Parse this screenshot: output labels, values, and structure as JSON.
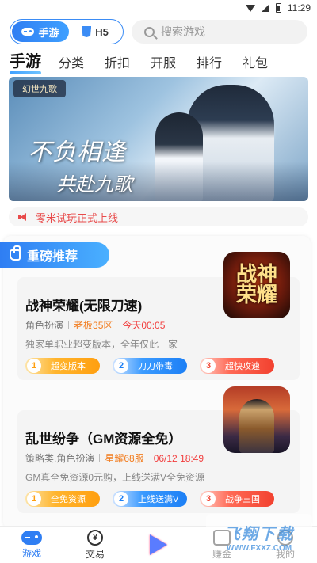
{
  "status_bar": {
    "time": "11:29"
  },
  "header": {
    "mode_active_label": "手游",
    "mode_inactive_label": "H5",
    "search_placeholder": "搜索游戏"
  },
  "tabs": [
    {
      "label": "手游",
      "active": true
    },
    {
      "label": "分类"
    },
    {
      "label": "折扣"
    },
    {
      "label": "开服"
    },
    {
      "label": "排行"
    },
    {
      "label": "礼包"
    }
  ],
  "banner": {
    "logo_text": "幻世九歌",
    "slogan_line1": "不负相逢",
    "slogan_line2": "共赴九歌"
  },
  "notice": {
    "text": "零米试玩正式上线"
  },
  "section": {
    "title": "重磅推荐",
    "games": [
      {
        "title": "战神荣耀(无限刀速)",
        "category": "角色扮演",
        "server": "老板35区",
        "time": "今天00:05",
        "desc": "独家单职业超变版本，全年仅此一家",
        "icon_text": "战神荣耀",
        "tags": [
          {
            "num": "1",
            "label": "超变版本",
            "color": "#ff9f10"
          },
          {
            "num": "2",
            "label": "刀刀带毒",
            "color": "#1c7ff5"
          },
          {
            "num": "3",
            "label": "超快攻速",
            "color": "#f2412f"
          }
        ]
      },
      {
        "title": "乱世纷争（GM资源全免）",
        "category": "策略类,角色扮演",
        "server": "星耀68服",
        "time": "06/12 18:49",
        "desc": "GM真全免资源0元购，上线送满V全免资源",
        "tags": [
          {
            "num": "1",
            "label": "全免资源",
            "color": "#ff9f10"
          },
          {
            "num": "2",
            "label": "上线送满V",
            "color": "#1c7ff5"
          },
          {
            "num": "3",
            "label": "战争三国",
            "color": "#f2412f"
          }
        ]
      }
    ]
  },
  "bottom_nav": [
    {
      "label": "游戏",
      "icon": "gamepad-icon",
      "active": true
    },
    {
      "label": "交易",
      "icon": "trade-icon"
    },
    {
      "label": "",
      "icon": "play-icon"
    },
    {
      "label": "赚金",
      "icon": "earn-icon"
    },
    {
      "label": "我的",
      "icon": "me-icon"
    }
  ],
  "watermark": {
    "main": "飞翔下载",
    "sub": "WWW.FXXZ.COM"
  },
  "colors": {
    "accent": "#2f7ef3",
    "notice": "#e84a4a",
    "server": "#f27c1e",
    "time": "#f23d3d"
  }
}
